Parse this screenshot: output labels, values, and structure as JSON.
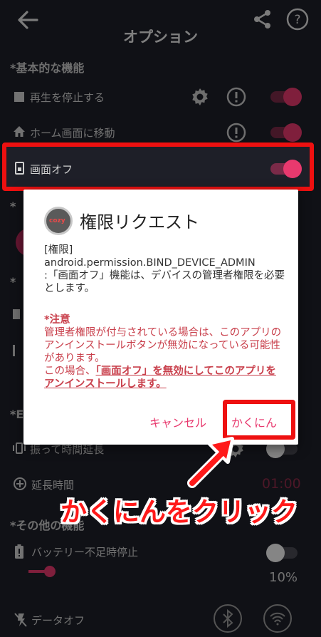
{
  "header": {
    "title": "オプション"
  },
  "sections": {
    "basic": "*基本的な機能",
    "other": "*その他の機能"
  },
  "rows": {
    "stop_play": "再生を停止する",
    "go_home": "ホーム画面に移動",
    "screen_off": "画面オフ",
    "shake_extend": "振って時間延長",
    "extend_time": "延長時間",
    "extend_time_value": "01:00",
    "battery_stop": "バッテリー不足時停止",
    "battery_value": "10%",
    "data_off": "データオフ"
  },
  "dialog": {
    "app_icon_text": "cozy",
    "title": "権限リクエスト",
    "body_line1": "[権限]",
    "body_line2": "android.permission.BIND_DEVICE_ADMIN",
    "body_line3": ":「画面オフ」機能は、デバイスの管理者権限を必要とします。",
    "note_head": "*注意",
    "note_text": "管理者権限が付与されている場合は、このアプリのアンインストールボタンが無効になっている可能性があります。",
    "note_prefix": "この場合、",
    "note_bold": "「画面オフ」を無効にしてこのアプリをアンインストールします。",
    "cancel_label": "キャンセル",
    "confirm_label": "かくにん"
  },
  "annotation": {
    "caption": "かくにんをクリック"
  },
  "colors": {
    "accent": "#e8396e",
    "highlight": "#ee1010",
    "background": "#1e1f28"
  }
}
